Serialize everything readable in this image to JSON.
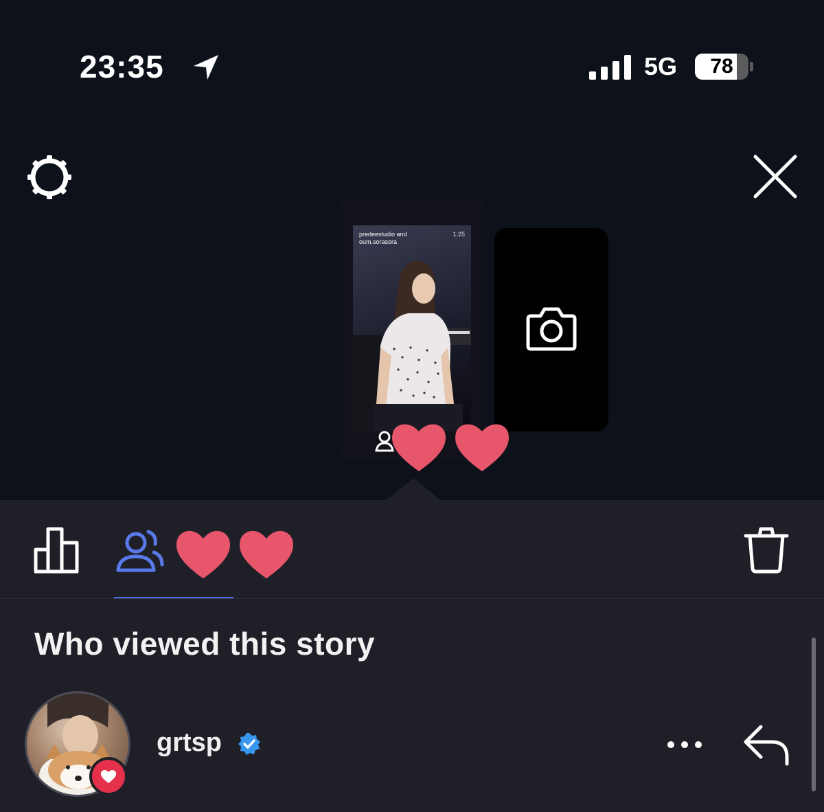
{
  "status_bar": {
    "time": "23:35",
    "network": "5G",
    "battery_percent": "78",
    "battery_level": 0.78,
    "location_icon": "location-arrow-icon",
    "signal_icon": "cellular-signal-icon"
  },
  "top_controls": {
    "settings_icon": "gear-icon",
    "close_icon": "close-icon"
  },
  "story_preview": {
    "owner": "predeestudio and oum.sorasora",
    "timestamp": "1:25",
    "viewers_icon": "viewers-icon"
  },
  "camera_card": {
    "icon": "camera-icon"
  },
  "sheet": {
    "insights_icon": "bar-chart-icon",
    "viewers_tab_icon": "viewers-icon",
    "delete_icon": "trash-icon",
    "heading": "Who viewed this story",
    "accent_color": "#4e6bdf"
  },
  "viewers": [
    {
      "username": "grtsp",
      "verified": true,
      "liked": true,
      "more_icon": "more-horizontal-icon",
      "reply_icon": "reply-icon"
    }
  ],
  "colors": {
    "heart": "#e8566c",
    "like_badge": "#e4304a",
    "verified": "#3897f0"
  }
}
